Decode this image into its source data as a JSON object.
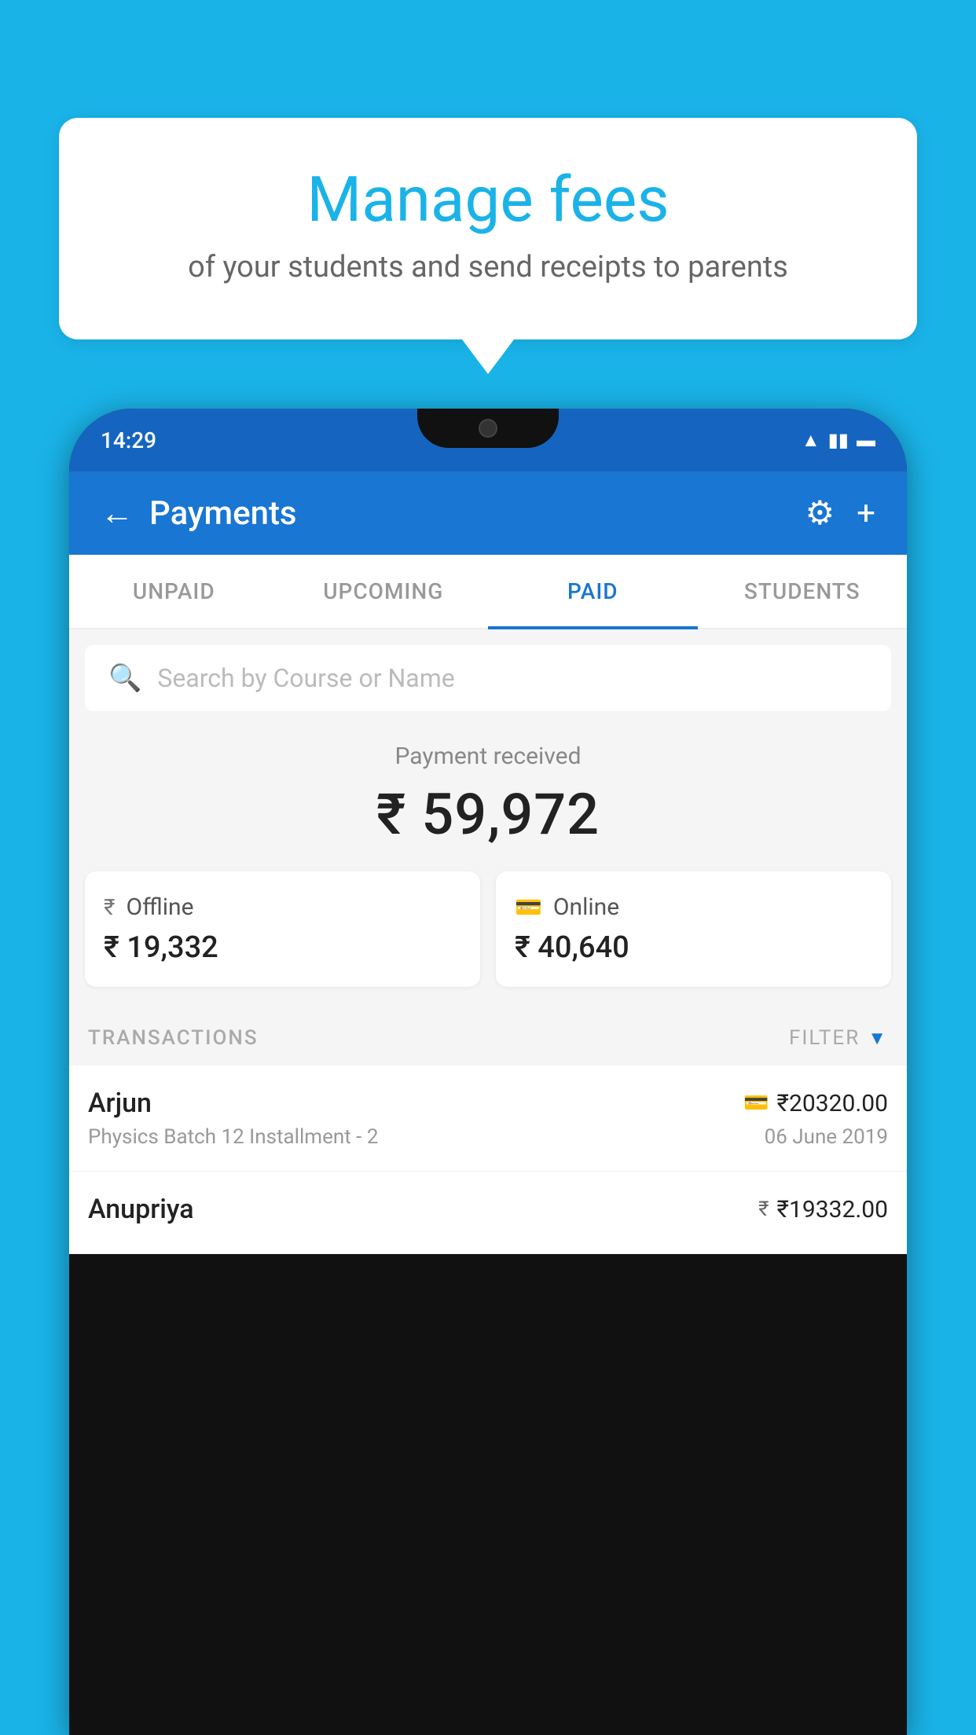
{
  "background_color": "#1ab3e8",
  "hero": {
    "title": "Manage fees",
    "subtitle": "of your students and send receipts to parents"
  },
  "status_bar": {
    "time": "14:29"
  },
  "header": {
    "title": "Payments",
    "back_label": "←",
    "settings_label": "⚙",
    "add_label": "+"
  },
  "tabs": [
    {
      "label": "UNPAID",
      "active": false
    },
    {
      "label": "UPCOMING",
      "active": false
    },
    {
      "label": "PAID",
      "active": true
    },
    {
      "label": "STUDENTS",
      "active": false
    }
  ],
  "search": {
    "placeholder": "Search by Course or Name"
  },
  "payment_summary": {
    "label": "Payment received",
    "total": "₹ 59,972",
    "offline_label": "Offline",
    "offline_amount": "₹ 19,332",
    "online_label": "Online",
    "online_amount": "₹ 40,640"
  },
  "transactions": {
    "header": "TRANSACTIONS",
    "filter": "FILTER",
    "rows": [
      {
        "name": "Arjun",
        "course": "Physics Batch 12 Installment - 2",
        "amount": "₹20320.00",
        "date": "06 June 2019",
        "method": "card"
      },
      {
        "name": "Anupriya",
        "course": "",
        "amount": "₹19332.00",
        "date": "",
        "method": "cash"
      }
    ]
  }
}
